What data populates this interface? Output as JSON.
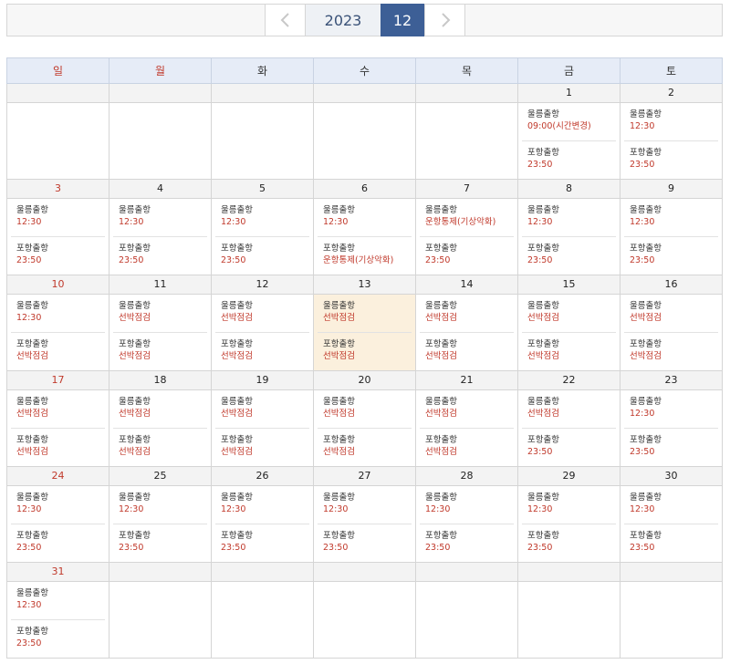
{
  "nav": {
    "prev_icon": "chevron-left-icon",
    "next_icon": "chevron-right-icon",
    "year": "2023",
    "month": "12"
  },
  "colors": {
    "accent": "#3d5f96",
    "header_bg": "#e6ecf7",
    "sunday_red": "#c0392b",
    "today_bg": "#fbf0dd"
  },
  "weekdays": [
    "일",
    "월",
    "화",
    "수",
    "목",
    "금",
    "토"
  ],
  "weeks": [
    [
      {
        "day": "",
        "entries": []
      },
      {
        "day": "",
        "entries": []
      },
      {
        "day": "",
        "entries": []
      },
      {
        "day": "",
        "entries": []
      },
      {
        "day": "",
        "entries": []
      },
      {
        "day": "1",
        "entries": [
          {
            "label": "울릉출항",
            "time": "09:00(시간변경)"
          },
          {
            "label": "포항출항",
            "time": "23:50"
          }
        ]
      },
      {
        "day": "2",
        "entries": [
          {
            "label": "울릉출항",
            "time": "12:30"
          },
          {
            "label": "포항출항",
            "time": "23:50"
          }
        ]
      }
    ],
    [
      {
        "day": "3",
        "entries": [
          {
            "label": "울릉출항",
            "time": "12:30"
          },
          {
            "label": "포항출항",
            "time": "23:50"
          }
        ]
      },
      {
        "day": "4",
        "entries": [
          {
            "label": "울릉출항",
            "time": "12:30"
          },
          {
            "label": "포항출항",
            "time": "23:50"
          }
        ]
      },
      {
        "day": "5",
        "entries": [
          {
            "label": "울릉출항",
            "time": "12:30"
          },
          {
            "label": "포항출항",
            "time": "23:50"
          }
        ]
      },
      {
        "day": "6",
        "entries": [
          {
            "label": "울릉출항",
            "time": "12:30"
          },
          {
            "label": "포항출항",
            "time": "운항통제(기상악화)"
          }
        ]
      },
      {
        "day": "7",
        "entries": [
          {
            "label": "울릉출항",
            "time": "운항통제(기상악화)"
          },
          {
            "label": "포항출항",
            "time": "23:50"
          }
        ]
      },
      {
        "day": "8",
        "entries": [
          {
            "label": "울릉출항",
            "time": "12:30"
          },
          {
            "label": "포항출항",
            "time": "23:50"
          }
        ]
      },
      {
        "day": "9",
        "entries": [
          {
            "label": "울릉출항",
            "time": "12:30"
          },
          {
            "label": "포항출항",
            "time": "23:50"
          }
        ]
      }
    ],
    [
      {
        "day": "10",
        "entries": [
          {
            "label": "울릉출항",
            "time": "12:30"
          },
          {
            "label": "포항출항",
            "time": "선박점검"
          }
        ]
      },
      {
        "day": "11",
        "entries": [
          {
            "label": "울릉출항",
            "time": "선박점검"
          },
          {
            "label": "포항출항",
            "time": "선박점검"
          }
        ]
      },
      {
        "day": "12",
        "entries": [
          {
            "label": "울릉출항",
            "time": "선박점검"
          },
          {
            "label": "포항출항",
            "time": "선박점검"
          }
        ]
      },
      {
        "day": "13",
        "today": true,
        "entries": [
          {
            "label": "울릉출항",
            "time": "선박점검"
          },
          {
            "label": "포항출항",
            "time": "선박점검"
          }
        ]
      },
      {
        "day": "14",
        "entries": [
          {
            "label": "울릉출항",
            "time": "선박점검"
          },
          {
            "label": "포항출항",
            "time": "선박점검"
          }
        ]
      },
      {
        "day": "15",
        "entries": [
          {
            "label": "울릉출항",
            "time": "선박점검"
          },
          {
            "label": "포항출항",
            "time": "선박점검"
          }
        ]
      },
      {
        "day": "16",
        "entries": [
          {
            "label": "울릉출항",
            "time": "선박점검"
          },
          {
            "label": "포항출항",
            "time": "선박점검"
          }
        ]
      }
    ],
    [
      {
        "day": "17",
        "entries": [
          {
            "label": "울릉출항",
            "time": "선박점검"
          },
          {
            "label": "포항출항",
            "time": "선박점검"
          }
        ]
      },
      {
        "day": "18",
        "entries": [
          {
            "label": "울릉출항",
            "time": "선박점검"
          },
          {
            "label": "포항출항",
            "time": "선박점검"
          }
        ]
      },
      {
        "day": "19",
        "entries": [
          {
            "label": "울릉출항",
            "time": "선박점검"
          },
          {
            "label": "포항출항",
            "time": "선박점검"
          }
        ]
      },
      {
        "day": "20",
        "entries": [
          {
            "label": "울릉출항",
            "time": "선박점검"
          },
          {
            "label": "포항출항",
            "time": "선박점검"
          }
        ]
      },
      {
        "day": "21",
        "entries": [
          {
            "label": "울릉출항",
            "time": "선박점검"
          },
          {
            "label": "포항출항",
            "time": "선박점검"
          }
        ]
      },
      {
        "day": "22",
        "entries": [
          {
            "label": "울릉출항",
            "time": "선박점검"
          },
          {
            "label": "포항출항",
            "time": "23:50"
          }
        ]
      },
      {
        "day": "23",
        "entries": [
          {
            "label": "울릉출항",
            "time": "12:30"
          },
          {
            "label": "포항출항",
            "time": "23:50"
          }
        ]
      }
    ],
    [
      {
        "day": "24",
        "entries": [
          {
            "label": "울릉출항",
            "time": "12:30"
          },
          {
            "label": "포항출항",
            "time": "23:50"
          }
        ]
      },
      {
        "day": "25",
        "entries": [
          {
            "label": "울릉출항",
            "time": "12:30"
          },
          {
            "label": "포항출항",
            "time": "23:50"
          }
        ]
      },
      {
        "day": "26",
        "entries": [
          {
            "label": "울릉출항",
            "time": "12:30"
          },
          {
            "label": "포항출항",
            "time": "23:50"
          }
        ]
      },
      {
        "day": "27",
        "entries": [
          {
            "label": "울릉출항",
            "time": "12:30"
          },
          {
            "label": "포항출항",
            "time": "23:50"
          }
        ]
      },
      {
        "day": "28",
        "entries": [
          {
            "label": "울릉출항",
            "time": "12:30"
          },
          {
            "label": "포항출항",
            "time": "23:50"
          }
        ]
      },
      {
        "day": "29",
        "entries": [
          {
            "label": "울릉출항",
            "time": "12:30"
          },
          {
            "label": "포항출항",
            "time": "23:50"
          }
        ]
      },
      {
        "day": "30",
        "entries": [
          {
            "label": "울릉출항",
            "time": "12:30"
          },
          {
            "label": "포항출항",
            "time": "23:50"
          }
        ]
      }
    ],
    [
      {
        "day": "31",
        "entries": [
          {
            "label": "울릉출항",
            "time": "12:30"
          },
          {
            "label": "포항출항",
            "time": "23:50"
          }
        ]
      },
      {
        "day": "",
        "entries": []
      },
      {
        "day": "",
        "entries": []
      },
      {
        "day": "",
        "entries": []
      },
      {
        "day": "",
        "entries": []
      },
      {
        "day": "",
        "entries": []
      },
      {
        "day": "",
        "entries": []
      }
    ]
  ]
}
